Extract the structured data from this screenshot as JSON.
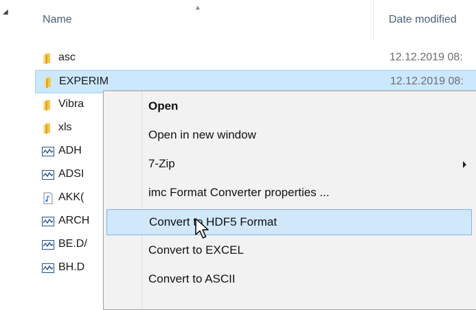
{
  "header": {
    "name_label": "Name",
    "date_label": "Date modified",
    "sort_icon": "sort-up-icon"
  },
  "files": [
    {
      "name": "asc",
      "date": "12.12.2019 08:",
      "icon": "folder-icon"
    },
    {
      "name": "EXPERIM",
      "date": "12.12.2019 08:",
      "icon": "folder-icon"
    },
    {
      "name": "Vibra",
      "date": "",
      "icon": "folder-icon"
    },
    {
      "name": "xls",
      "date": "",
      "icon": "folder-icon"
    },
    {
      "name": "ADH",
      "date": "",
      "icon": "waveform-file-icon"
    },
    {
      "name": "ADSI",
      "date": "",
      "icon": "waveform-file-icon"
    },
    {
      "name": "AKK(",
      "date": "",
      "icon": "audio-file-icon"
    },
    {
      "name": "ARCH",
      "date": "",
      "icon": "waveform-file-icon"
    },
    {
      "name": "BE.D/",
      "date": "",
      "icon": "waveform-file-icon"
    },
    {
      "name": "BH.D",
      "date": "",
      "icon": "waveform-file-icon"
    }
  ],
  "context_menu": {
    "items": [
      {
        "label": "Open"
      },
      {
        "label": "Open in new window"
      },
      {
        "label": "7-Zip"
      },
      {
        "label": "imc Format Converter properties ..."
      },
      {
        "label": "Convert to HDF5 Format"
      },
      {
        "label": "Convert to EXCEL"
      },
      {
        "label": "Convert to ASCII"
      }
    ]
  },
  "colors": {
    "selection_bg": "#cce8ff",
    "selection_border": "#99d1ff",
    "menu_highlight": "#d1e7fa",
    "folder": "#f4c651",
    "waveform": "#1f4e8c"
  }
}
